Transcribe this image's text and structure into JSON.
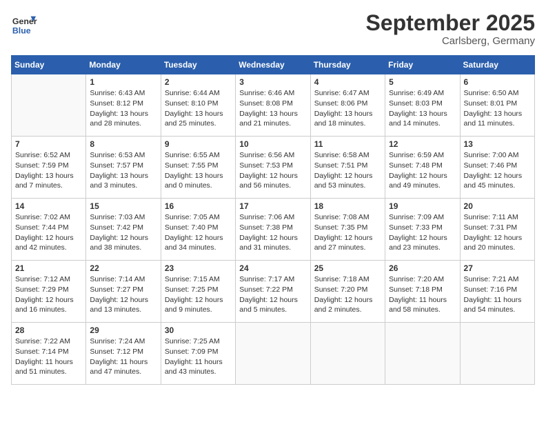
{
  "header": {
    "logo_general": "General",
    "logo_blue": "Blue",
    "month": "September 2025",
    "location": "Carlsberg, Germany"
  },
  "days_of_week": [
    "Sunday",
    "Monday",
    "Tuesday",
    "Wednesday",
    "Thursday",
    "Friday",
    "Saturday"
  ],
  "weeks": [
    [
      {
        "day": "",
        "info": ""
      },
      {
        "day": "1",
        "info": "Sunrise: 6:43 AM\nSunset: 8:12 PM\nDaylight: 13 hours\nand 28 minutes."
      },
      {
        "day": "2",
        "info": "Sunrise: 6:44 AM\nSunset: 8:10 PM\nDaylight: 13 hours\nand 25 minutes."
      },
      {
        "day": "3",
        "info": "Sunrise: 6:46 AM\nSunset: 8:08 PM\nDaylight: 13 hours\nand 21 minutes."
      },
      {
        "day": "4",
        "info": "Sunrise: 6:47 AM\nSunset: 8:06 PM\nDaylight: 13 hours\nand 18 minutes."
      },
      {
        "day": "5",
        "info": "Sunrise: 6:49 AM\nSunset: 8:03 PM\nDaylight: 13 hours\nand 14 minutes."
      },
      {
        "day": "6",
        "info": "Sunrise: 6:50 AM\nSunset: 8:01 PM\nDaylight: 13 hours\nand 11 minutes."
      }
    ],
    [
      {
        "day": "7",
        "info": "Sunrise: 6:52 AM\nSunset: 7:59 PM\nDaylight: 13 hours\nand 7 minutes."
      },
      {
        "day": "8",
        "info": "Sunrise: 6:53 AM\nSunset: 7:57 PM\nDaylight: 13 hours\nand 3 minutes."
      },
      {
        "day": "9",
        "info": "Sunrise: 6:55 AM\nSunset: 7:55 PM\nDaylight: 13 hours\nand 0 minutes."
      },
      {
        "day": "10",
        "info": "Sunrise: 6:56 AM\nSunset: 7:53 PM\nDaylight: 12 hours\nand 56 minutes."
      },
      {
        "day": "11",
        "info": "Sunrise: 6:58 AM\nSunset: 7:51 PM\nDaylight: 12 hours\nand 53 minutes."
      },
      {
        "day": "12",
        "info": "Sunrise: 6:59 AM\nSunset: 7:48 PM\nDaylight: 12 hours\nand 49 minutes."
      },
      {
        "day": "13",
        "info": "Sunrise: 7:00 AM\nSunset: 7:46 PM\nDaylight: 12 hours\nand 45 minutes."
      }
    ],
    [
      {
        "day": "14",
        "info": "Sunrise: 7:02 AM\nSunset: 7:44 PM\nDaylight: 12 hours\nand 42 minutes."
      },
      {
        "day": "15",
        "info": "Sunrise: 7:03 AM\nSunset: 7:42 PM\nDaylight: 12 hours\nand 38 minutes."
      },
      {
        "day": "16",
        "info": "Sunrise: 7:05 AM\nSunset: 7:40 PM\nDaylight: 12 hours\nand 34 minutes."
      },
      {
        "day": "17",
        "info": "Sunrise: 7:06 AM\nSunset: 7:38 PM\nDaylight: 12 hours\nand 31 minutes."
      },
      {
        "day": "18",
        "info": "Sunrise: 7:08 AM\nSunset: 7:35 PM\nDaylight: 12 hours\nand 27 minutes."
      },
      {
        "day": "19",
        "info": "Sunrise: 7:09 AM\nSunset: 7:33 PM\nDaylight: 12 hours\nand 23 minutes."
      },
      {
        "day": "20",
        "info": "Sunrise: 7:11 AM\nSunset: 7:31 PM\nDaylight: 12 hours\nand 20 minutes."
      }
    ],
    [
      {
        "day": "21",
        "info": "Sunrise: 7:12 AM\nSunset: 7:29 PM\nDaylight: 12 hours\nand 16 minutes."
      },
      {
        "day": "22",
        "info": "Sunrise: 7:14 AM\nSunset: 7:27 PM\nDaylight: 12 hours\nand 13 minutes."
      },
      {
        "day": "23",
        "info": "Sunrise: 7:15 AM\nSunset: 7:25 PM\nDaylight: 12 hours\nand 9 minutes."
      },
      {
        "day": "24",
        "info": "Sunrise: 7:17 AM\nSunset: 7:22 PM\nDaylight: 12 hours\nand 5 minutes."
      },
      {
        "day": "25",
        "info": "Sunrise: 7:18 AM\nSunset: 7:20 PM\nDaylight: 12 hours\nand 2 minutes."
      },
      {
        "day": "26",
        "info": "Sunrise: 7:20 AM\nSunset: 7:18 PM\nDaylight: 11 hours\nand 58 minutes."
      },
      {
        "day": "27",
        "info": "Sunrise: 7:21 AM\nSunset: 7:16 PM\nDaylight: 11 hours\nand 54 minutes."
      }
    ],
    [
      {
        "day": "28",
        "info": "Sunrise: 7:22 AM\nSunset: 7:14 PM\nDaylight: 11 hours\nand 51 minutes."
      },
      {
        "day": "29",
        "info": "Sunrise: 7:24 AM\nSunset: 7:12 PM\nDaylight: 11 hours\nand 47 minutes."
      },
      {
        "day": "30",
        "info": "Sunrise: 7:25 AM\nSunset: 7:09 PM\nDaylight: 11 hours\nand 43 minutes."
      },
      {
        "day": "",
        "info": ""
      },
      {
        "day": "",
        "info": ""
      },
      {
        "day": "",
        "info": ""
      },
      {
        "day": "",
        "info": ""
      }
    ]
  ]
}
